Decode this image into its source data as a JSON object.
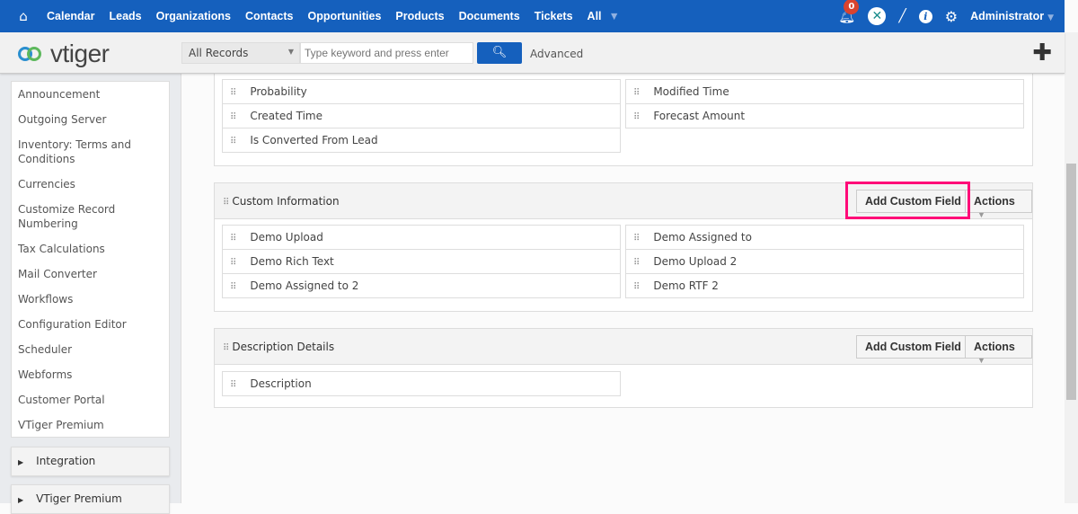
{
  "topnav": {
    "items": [
      "Calendar",
      "Leads",
      "Organizations",
      "Contacts",
      "Opportunities",
      "Products",
      "Documents",
      "Tickets",
      "All"
    ],
    "notification_count": "0",
    "user": "Administrator"
  },
  "header": {
    "logo": "vtiger",
    "record_filter": "All Records",
    "search_placeholder": "Type keyword and press enter",
    "advanced": "Advanced"
  },
  "sidebar": {
    "items": [
      "Announcement",
      "Outgoing Server",
      "Inventory: Terms and Conditions",
      "Currencies",
      "Customize Record Numbering",
      "Tax Calculations",
      "Mail Converter",
      "Workflows",
      "Configuration Editor",
      "Scheduler",
      "Webforms",
      "Customer Portal",
      "VTiger Premium"
    ],
    "groups": [
      "Integration",
      "VTiger Premium"
    ]
  },
  "blocks": {
    "top": {
      "left": [
        "Probability",
        "Created Time",
        "Is Converted From Lead"
      ],
      "right": [
        "Modified Time",
        "Forecast Amount"
      ]
    },
    "custom": {
      "title": "Custom Information",
      "add": "Add Custom Field",
      "actions": "Actions",
      "left": [
        "Demo Upload",
        "Demo Rich Text",
        "Demo Assigned to 2"
      ],
      "right": [
        "Demo Assigned to",
        "Demo Upload 2",
        "Demo RTF 2"
      ]
    },
    "description": {
      "title": "Description Details",
      "add": "Add Custom Field",
      "actions": "Actions",
      "left": [
        "Description"
      ]
    }
  },
  "highlight_color": "#ff0a78"
}
